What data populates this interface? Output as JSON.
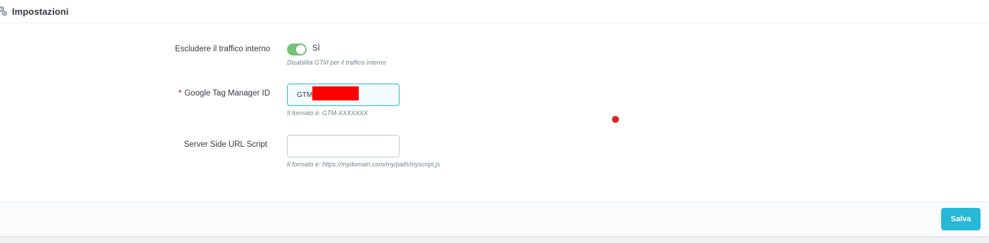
{
  "panel": {
    "title": "Impostazioni",
    "icon": "cogs-icon"
  },
  "fields": {
    "exclude_internal": {
      "label": "Escludere il traffico interno",
      "toggle_value": "SÌ",
      "toggle_on": true,
      "help": "Disabilita GTM per il traffico interno"
    },
    "gtm_id": {
      "required": "*",
      "label": "Google Tag Manager ID",
      "value": "GTM-",
      "help": "Il formato è: GTM-XXXXXXX"
    },
    "server_side_url": {
      "label": "Server Side URL Script",
      "value": "",
      "help": "Il formato è: https://mydomain.com/my/path/myscript.js"
    }
  },
  "footer": {
    "save_label": "Salva"
  },
  "colors": {
    "accent": "#25b9d7",
    "toggle_on": "#72c279",
    "required": "#c05c67",
    "redaction": "#ff0000",
    "marker_dot": "#e0261f"
  }
}
